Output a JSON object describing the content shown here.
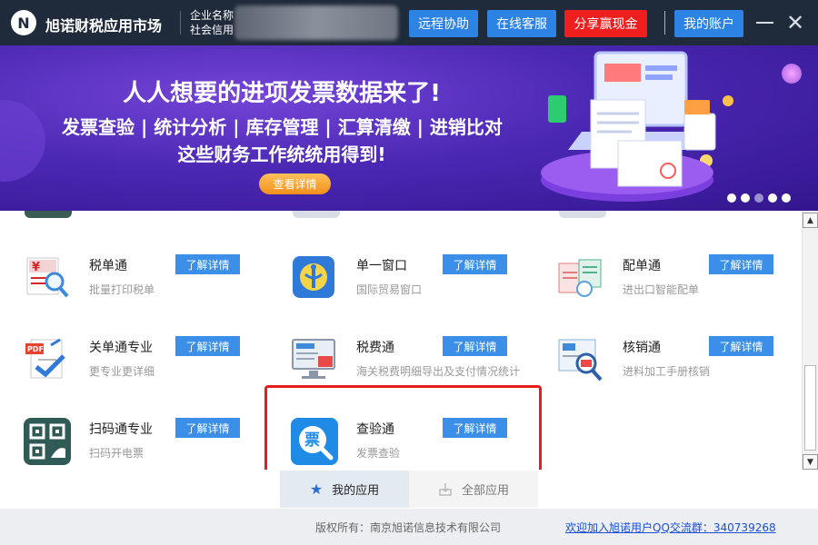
{
  "titlebar": {
    "app_title": "旭诺财税应用市场",
    "company_label": "企业名称",
    "credit_label": "社会信用",
    "buttons": {
      "remote_assist": "远程协助",
      "online_service": "在线客服",
      "share_cash": "分享赢现金",
      "my_account": "我的账户"
    },
    "colors": {
      "bar": "#1f2a3a",
      "blue_button": "#2d83e3",
      "red_button": "#ef1f1f"
    }
  },
  "banner": {
    "headline": "人人想要的进项发票数据来了!",
    "features": "发票查验 | 统计分析 | 库存管理 | 汇算清缴 | 进销比对",
    "subline": "这些财务工作统统用得到!",
    "button": "查看详情",
    "dots_total": 5,
    "active_dot": 3
  },
  "apps": {
    "btn_label": "了解详情",
    "items": [
      {
        "name": "税单通",
        "desc": "批量打印税单",
        "icon": "tax-receipt-magnifier-icon"
      },
      {
        "name": "单一窗口",
        "desc": "国际贸易窗口",
        "icon": "customs-emblem-icon"
      },
      {
        "name": "配单通",
        "desc": "进出口智能配单",
        "icon": "document-matching-icon"
      },
      {
        "name": "关单通专业",
        "desc": "更专业更详细",
        "icon": "pdf-checkmark-icon"
      },
      {
        "name": "税费通",
        "desc": "海关税费明细导出及支付情况统计",
        "icon": "tax-monitor-icon"
      },
      {
        "name": "核销通",
        "desc": "进料加工手册核销",
        "icon": "verification-magnifier-icon"
      },
      {
        "name": "扫码通专业",
        "desc": "扫码开电票",
        "icon": "qr-code-icon"
      },
      {
        "name": "查验通",
        "desc": "发票查验",
        "icon": "invoice-search-icon",
        "highlighted": true
      }
    ]
  },
  "tabs": {
    "mine": "我的应用",
    "all": "全部应用",
    "active": "mine"
  },
  "footer": {
    "copyright": "版权所有：南京旭诺信息技术有限公司",
    "qq_link": "欢迎加入旭诺用户QQ交流群：340739268"
  }
}
